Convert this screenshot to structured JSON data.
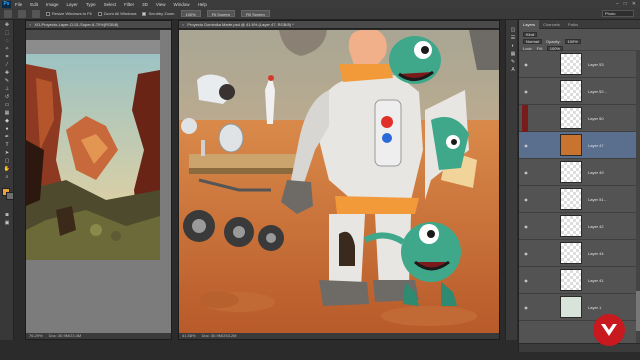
{
  "app": {
    "logo_text": "Ps"
  },
  "menu": [
    "File",
    "Edit",
    "Image",
    "Layer",
    "Type",
    "Select",
    "Filter",
    "3D",
    "View",
    "Window",
    "Help"
  ],
  "window_controls": [
    "–",
    "□",
    "✕"
  ],
  "options_bar": {
    "resize_windows_label": "Resize Windows to Fit",
    "zoom_all_label": "Zoom All Windows",
    "scrubby_zoom_label": "Scrubby Zoom",
    "btn_100": "100%",
    "btn_fit_screen": "Fit Screen",
    "btn_fill_screen": "Fill Screen",
    "workspace": "Photo"
  },
  "colors": {
    "foreground": "#e8a33c",
    "background": "#6e6e6e",
    "accent_selected_layer": "#5a6e8e"
  },
  "doc_left": {
    "tab": "XO-Proyecto-Layer-O-51-Super-8-70%(RGB/8)",
    "zoom": "76.29%",
    "doc_size": "Doc: 30.9M/23.4M"
  },
  "doc_main": {
    "tab": "Proyecto Dominika Marte.psd @ 41.6% (Layer 47, RGB/8) *",
    "zoom": "41.58%",
    "doc_size": "Doc: 30.9M/253.2M"
  },
  "layers_panel": {
    "tabs": [
      "Layers",
      "Channels",
      "Paths"
    ],
    "kind_label": "Kind",
    "blend_mode": "Normal",
    "opacity_label": "Opacity:",
    "opacity_value": "100%",
    "lock_label": "Lock:",
    "fill_label": "Fill:",
    "fill_value": "100%",
    "layers": [
      {
        "name": "Layer 53"
      },
      {
        "name": "Layer 52..."
      },
      {
        "name": "Layer 50"
      },
      {
        "name": "Layer 47"
      },
      {
        "name": "Layer 49"
      },
      {
        "name": "Layer 51..."
      },
      {
        "name": "Layer 42"
      },
      {
        "name": "Layer 44"
      },
      {
        "name": "Layer 41"
      },
      {
        "name": "Layer 1"
      }
    ]
  }
}
